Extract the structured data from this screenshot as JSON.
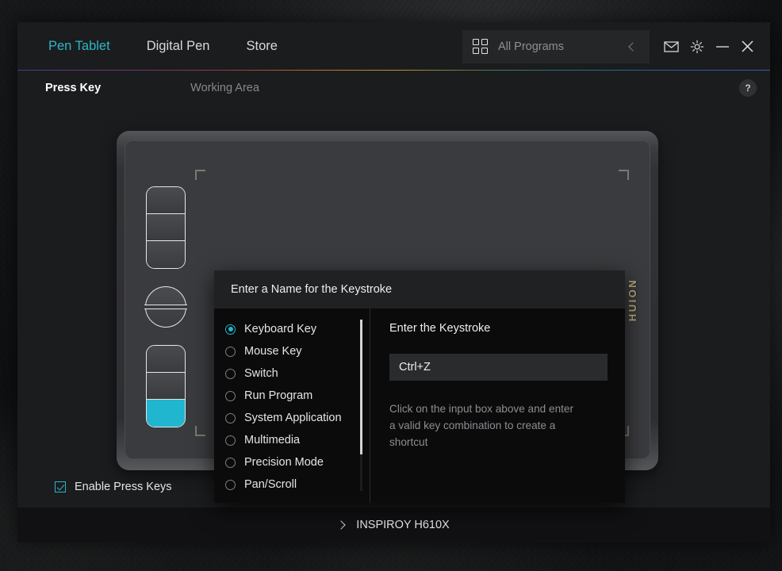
{
  "header": {
    "tabs": [
      {
        "label": "Pen Tablet",
        "active": true
      },
      {
        "label": "Digital Pen",
        "active": false
      },
      {
        "label": "Store",
        "active": false
      }
    ],
    "programs_selector": {
      "label": "All Programs",
      "grid_icon": "grid-icon",
      "collapse_icon": "chevron-left-icon"
    },
    "window_controls": {
      "mail": "mail-icon",
      "settings": "gear-icon",
      "minimize": "minimize-icon",
      "close": "close-icon"
    },
    "accent_color": "#2fb6c9"
  },
  "subnav": {
    "items": [
      {
        "label": "Press Key",
        "active": true
      },
      {
        "label": "Working Area",
        "active": false
      }
    ],
    "help_label": "?"
  },
  "tablet": {
    "brand": "HUION",
    "brand_color": "#b9ad7e",
    "active_key_color": "#21b6cf",
    "top_keys": 3,
    "bottom_keys": 3,
    "active_key_index": 2,
    "has_dial": true
  },
  "dialog": {
    "title": "Enter a Name for the Keystroke",
    "options": [
      {
        "label": "Keyboard Key",
        "selected": true
      },
      {
        "label": "Mouse Key",
        "selected": false
      },
      {
        "label": "Switch",
        "selected": false
      },
      {
        "label": "Run Program",
        "selected": false
      },
      {
        "label": "System Application",
        "selected": false
      },
      {
        "label": "Multimedia",
        "selected": false
      },
      {
        "label": "Precision Mode",
        "selected": false
      },
      {
        "label": "Pan/Scroll",
        "selected": false
      }
    ],
    "keystroke": {
      "title": "Enter the Keystroke",
      "value": "Ctrl+Z",
      "placeholder": "Ctrl+Z",
      "hint": "Click on the input box above and enter a valid key combination to create a shortcut"
    }
  },
  "footer": {
    "enable_press_keys": {
      "label": "Enable Press Keys",
      "checked": true,
      "color": "#2bb5cc"
    },
    "device": {
      "name": "INSPIROY H610X",
      "expand_icon": "chevron-right-icon"
    }
  }
}
